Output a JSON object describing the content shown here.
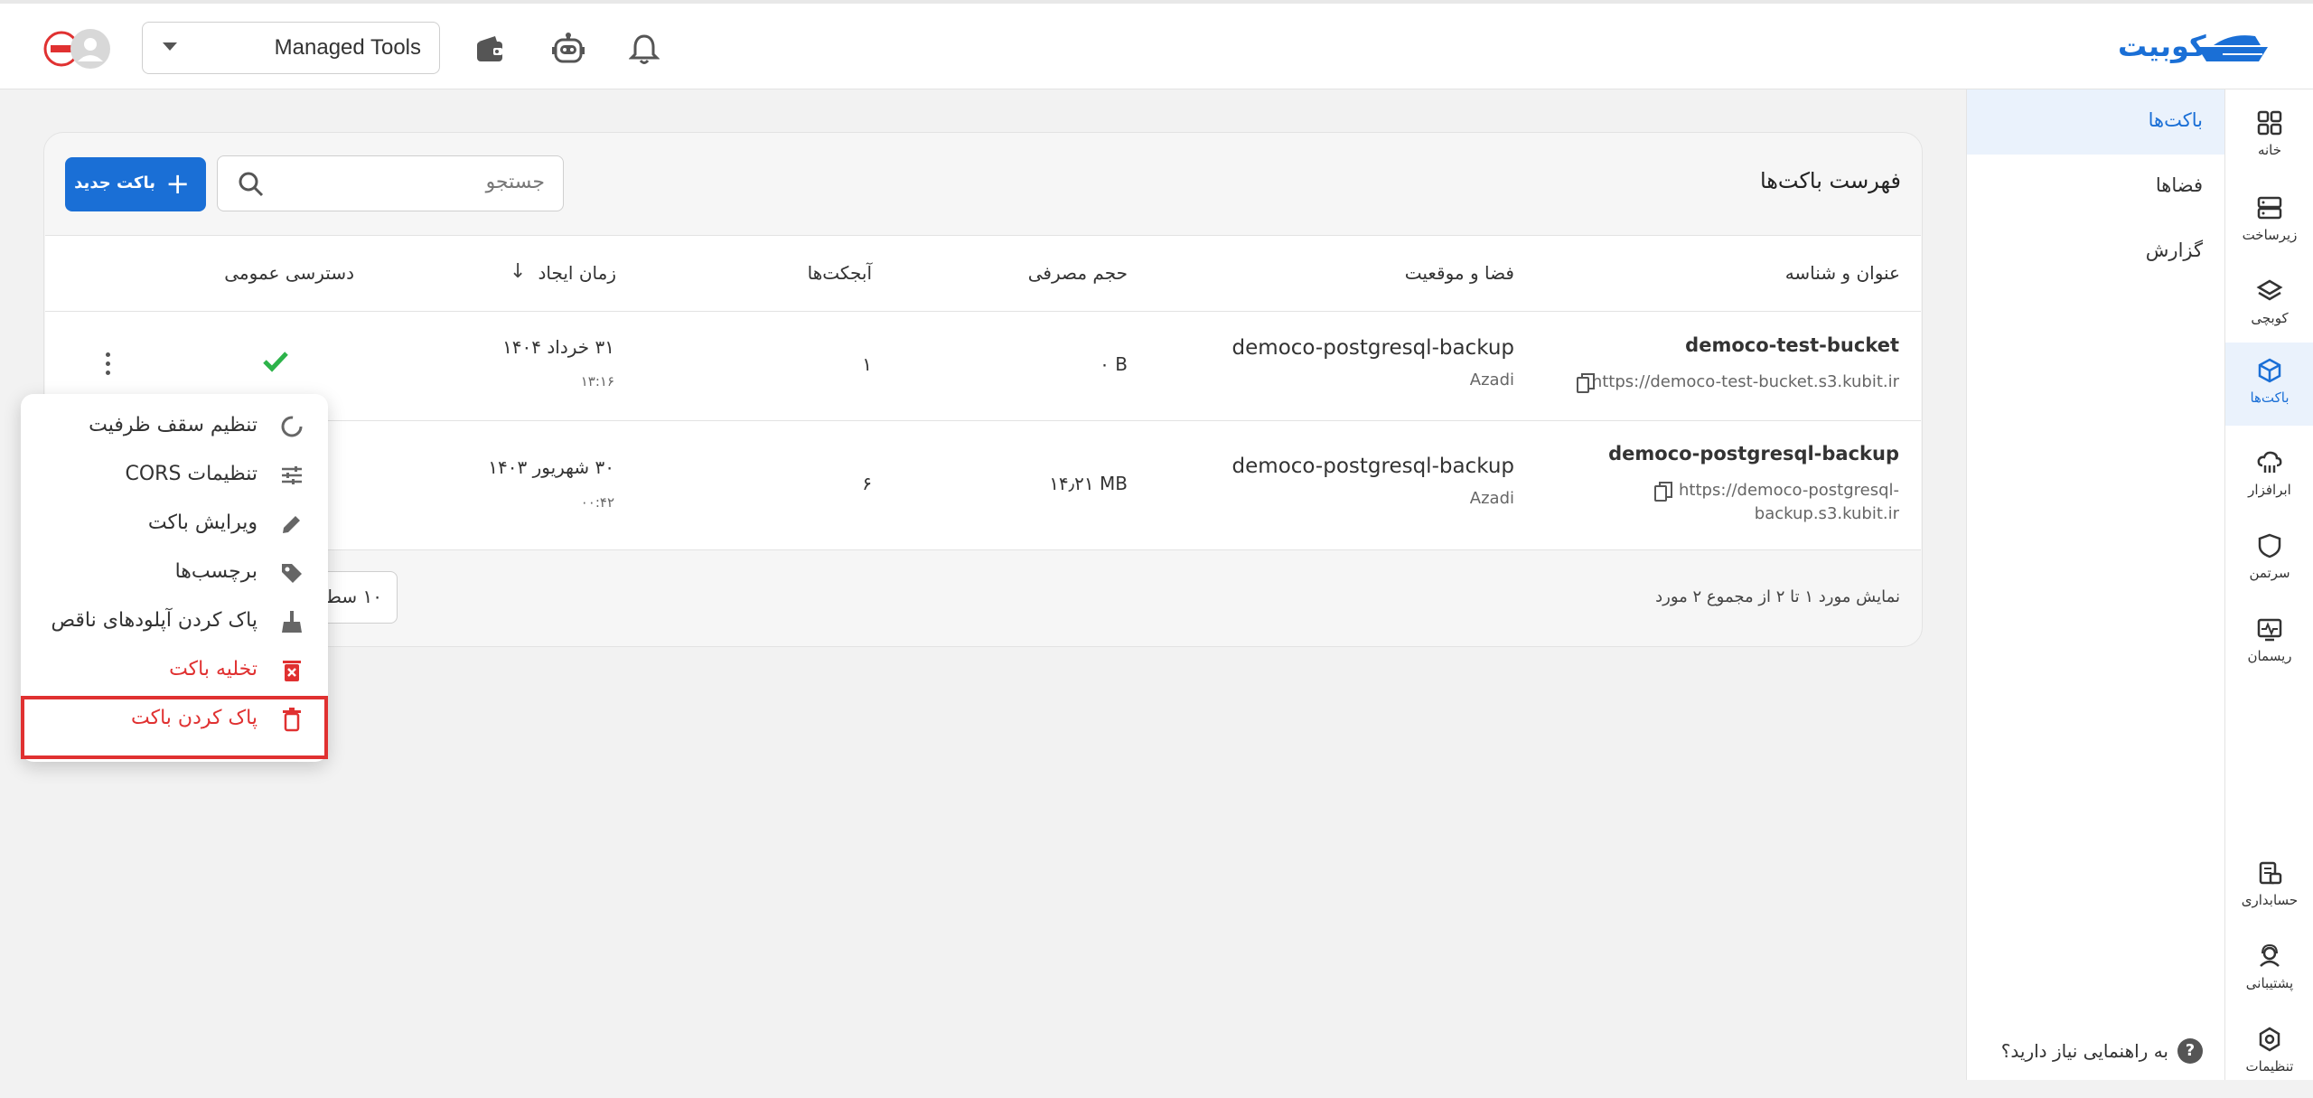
{
  "app": {
    "logo_text": "کوبیت",
    "brand_color": "#1a6fd6",
    "danger_color": "#e03131",
    "success_color": "#2db34a"
  },
  "topbar": {
    "org_selector_value": "Managed Tools"
  },
  "rail": {
    "items": [
      {
        "label": "خانه",
        "icon": "grid-icon"
      },
      {
        "label": "زیرساخت",
        "icon": "server-icon"
      },
      {
        "label": "کوبچی",
        "icon": "layers-icon"
      },
      {
        "label": "باکت‌ها",
        "icon": "cube-icon"
      },
      {
        "label": "ابرافزار",
        "icon": "cloud-app-icon"
      },
      {
        "label": "سرتمن",
        "icon": "shield-icon"
      },
      {
        "label": "ریسمان",
        "icon": "monitor-pulse-icon"
      },
      {
        "label": "حسابداری",
        "icon": "invoice-icon"
      },
      {
        "label": "پشتیبانی",
        "icon": "support-icon"
      },
      {
        "label": "تنظیمات",
        "icon": "settings-icon"
      }
    ]
  },
  "subnav": {
    "items": [
      "باکت‌ها",
      "فضاها",
      "گزارش"
    ],
    "help_text": "به راهنمایی نیاز دارید؟"
  },
  "card": {
    "title": "فهرست باکت‌ها",
    "search_placeholder": "جستجو",
    "new_bucket_label": "باکت جدید"
  },
  "table": {
    "headers": {
      "name": "عنوان و شناسه",
      "space": "فضا و موقعیت",
      "usage": "حجم مصرفی",
      "objects": "آبجکت‌ها",
      "created": "زمان ایجاد",
      "public": "دسترسی عمومی"
    },
    "rows": [
      {
        "name": "democo-test-bucket",
        "url": "https://democo-test-bucket.s3.kubit.ir",
        "space": "democo-postgresql-backup",
        "location": "Azadi",
        "usage": "۰ B",
        "objects": "۱",
        "date": "۳۱ خرداد ۱۴۰۴",
        "time": "۱۳:۱۶",
        "public": true
      },
      {
        "name": "democo-postgresql-backup",
        "url_line1": "https://democo-postgresql-",
        "url_line2": "backup.s3.kubit.ir",
        "space": "democo-postgresql-backup",
        "location": "Azadi",
        "usage": "۱۴٫۲۱ MB",
        "objects": "۶",
        "date": "۳۰ شهریور ۱۴۰۳",
        "time": "۰۰:۴۲",
        "public": false
      }
    ],
    "pagination_text": "نمایش مورد ۱ تا ۲ از مجموع ۲ مورد",
    "rows_per_page": "۱۰ سط"
  },
  "context_menu": {
    "items": [
      {
        "label": "تنظیم سقف ظرفیت",
        "icon": "capacity-icon",
        "danger": false
      },
      {
        "label": "تنظیمات CORS",
        "icon": "sliders-icon",
        "danger": false
      },
      {
        "label": "ویرایش باکت",
        "icon": "pencil-icon",
        "danger": false
      },
      {
        "label": "برچسب‌ها",
        "icon": "tag-icon",
        "danger": false
      },
      {
        "label": "پاک کردن آپلودهای ناقص",
        "icon": "broom-icon",
        "danger": false
      },
      {
        "label": "تخلیه باکت",
        "icon": "empty-bin-icon",
        "danger": true
      },
      {
        "label": "پاک کردن باکت",
        "icon": "trash-icon",
        "danger": true
      }
    ],
    "highlighted_item": "پاک کردن باکت"
  }
}
